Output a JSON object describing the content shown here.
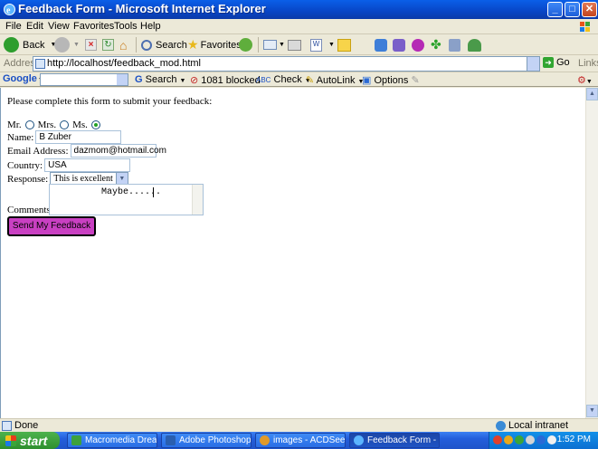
{
  "window": {
    "title": "Feedback Form - Microsoft Internet Explorer",
    "min": "_",
    "max": "□",
    "close": "✕"
  },
  "menu": [
    "File",
    "Edit",
    "View",
    "Favorites",
    "Tools",
    "Help"
  ],
  "toolbar": {
    "back": "Back",
    "search": "Search",
    "favorites": "Favorites"
  },
  "address": {
    "label": "Address",
    "url": "http://localhost/feedback_mod.html",
    "go": "Go",
    "links": "Links"
  },
  "google_bar": {
    "logo": "Google",
    "search": "Search",
    "blocked": "1081 blocked",
    "check": "Check",
    "autolink": "AutoLink",
    "options": "Options"
  },
  "form": {
    "intro": "Please complete this form to submit your feedback:",
    "titles": [
      "Mr.",
      "Mrs.",
      "Ms."
    ],
    "selected_title": "Ms.",
    "name_label": "Name:",
    "name_value": "B Zuber",
    "email_label": "Email Address:",
    "email_value": "dazmom@hotmail.com",
    "country_label": "Country:",
    "country_value": "USA",
    "response_label": "Response:",
    "response_value": "This is excellent",
    "comments_label": "Comments:",
    "comments_value": "Maybe......",
    "submit_label": "Send My Feedback"
  },
  "status": {
    "text": "Done",
    "zone": "Local intranet"
  },
  "taskbar": {
    "start": "start",
    "tasks": [
      {
        "label": "Macromedia Drea...",
        "active": false
      },
      {
        "label": "Adobe Photoshop",
        "active": false
      },
      {
        "label": "images - ACDSee ...",
        "active": false
      },
      {
        "label": "Feedback Form - ...",
        "active": true
      }
    ],
    "clock": "1:52 PM"
  },
  "colors": {
    "submit_bg": "#c940c2",
    "titlebar": "#0a5fe8",
    "start_green": "#3aa53a"
  }
}
